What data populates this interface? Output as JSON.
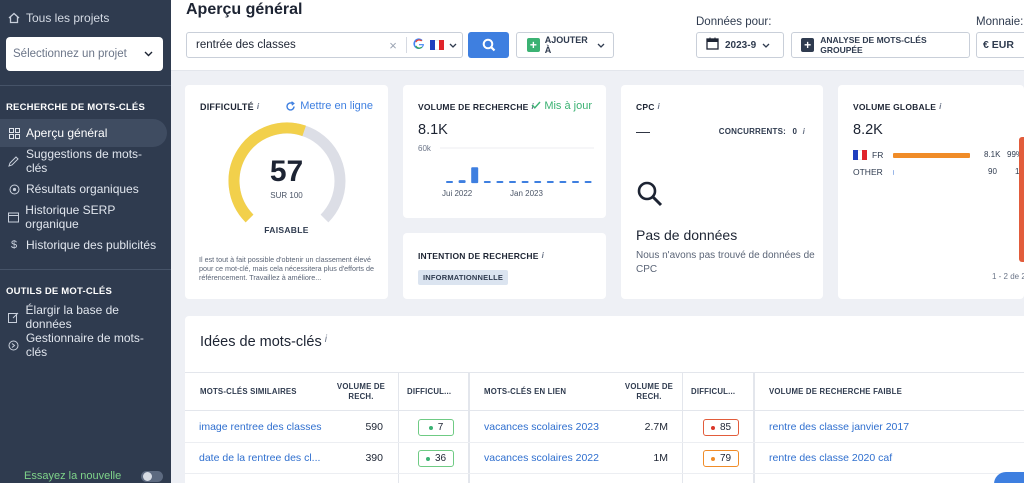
{
  "sidebar": {
    "all_projects": "Tous les projets",
    "project_select_placeholder": "Sélectionnez un projet",
    "section1": "RECHERCHE DE MOTS-CLÉS",
    "items1": [
      {
        "label": "Aperçu général",
        "icon": "grid-icon",
        "active": true
      },
      {
        "label": "Suggestions de mots-clés",
        "icon": "pencil-icon"
      },
      {
        "label": "Résultats organiques",
        "icon": "circle-target-icon"
      },
      {
        "label": "Historique SERP organique",
        "icon": "window-icon"
      },
      {
        "label": "Historique des publicités",
        "icon": "dollar-icon"
      }
    ],
    "section2": "OUTILS DE MOT-CLÉS",
    "items2": [
      {
        "label": "Élargir la base de données",
        "icon": "edit-box-icon"
      },
      {
        "label": "Gestionnaire de mots-clés",
        "icon": "circle-arrow-icon"
      }
    ],
    "bottom_label": "Essayez la nouvelle"
  },
  "header": {
    "title": "Aperçu général",
    "keyword": "rentrée des classes",
    "add_to": "AJOUTER À",
    "data_for_label": "Données pour:",
    "date": "2023-9",
    "bulk_analysis": "ANALYSE DE MOTS-CLÉS GROUPÉE",
    "currency_label": "Monnaie:",
    "currency": "€ EUR"
  },
  "difficulty": {
    "title": "DIFFICULTÉ",
    "refresh": "Mettre en ligne",
    "value": "57",
    "value_num": 57,
    "out_of": "SUR 100",
    "label": "FAISABLE",
    "description": "Il est tout à fait possible d'obtenir un classement élevé pour ce mot-clé, mais cela nécessitera plus d'efforts de référencement. Travaillez à améliore..."
  },
  "search_volume": {
    "title": "VOLUME DE RECHERCHE",
    "status": "Mis à jour",
    "value": "8.1K",
    "y_tick": "60k",
    "x_ticks": [
      "Jui 2022",
      "Jan 2023"
    ]
  },
  "intent": {
    "title": "INTENTION DE RECHERCHE",
    "badge": "INFORMATIONNELLE"
  },
  "cpc": {
    "title": "CPC",
    "value": "—",
    "competitors_label": "CONCURRENTS:",
    "competitors_value": "0",
    "empty_title": "Pas de données",
    "empty_desc": "Nous n'avons pas trouvé de données de CPC"
  },
  "global_volume": {
    "title": "VOLUME GLOBALE",
    "value": "8.2K",
    "rows": [
      {
        "country": "FR",
        "value": "8.1K",
        "pct": "99%",
        "share": 0.99
      },
      {
        "country": "OTHER",
        "value": "90",
        "pct": "1%",
        "share": 0.01
      }
    ],
    "footer": "1 - 2 de 2"
  },
  "chart_data": {
    "type": "bar",
    "categories": [
      "",
      "",
      "",
      "",
      "",
      "",
      "",
      "",
      "",
      "",
      "",
      ""
    ],
    "values": [
      1000,
      5000,
      27000,
      3500,
      1200,
      800,
      700,
      1000,
      800,
      1200,
      1800,
      2500
    ],
    "ylim": [
      0,
      60000
    ],
    "y_ticks": [
      "60k"
    ],
    "x_tick_labels": [
      "Jui 2022",
      "Jan 2023"
    ]
  },
  "ideas": {
    "title": "Idées de mots-clés",
    "headers": {
      "similar": "MOTS-CLÉS SIMILAIRES",
      "vol1": "VOLUME DE RECH.",
      "diff1": "DIFFICUL...",
      "related": "MOTS-CLÉS EN LIEN",
      "vol2": "VOLUME DE RECH.",
      "diff2": "DIFFICUL...",
      "low": "VOLUME DE RECHERCHE FAIBLE"
    },
    "rows": [
      {
        "similar": "image rentree des classes",
        "vol1": "590",
        "diff1": "7",
        "related": "vacances scolaires 2023",
        "vol2": "2.7M",
        "diff2": "85",
        "low": "rentre des classe janvier 2017"
      },
      {
        "similar": "date de la rentree des cl...",
        "vol1": "390",
        "diff1": "36",
        "related": "vacances scolaires 2022",
        "vol2": "1M",
        "diff2": "79",
        "low": "rentre des classe 2020 caf"
      }
    ]
  }
}
